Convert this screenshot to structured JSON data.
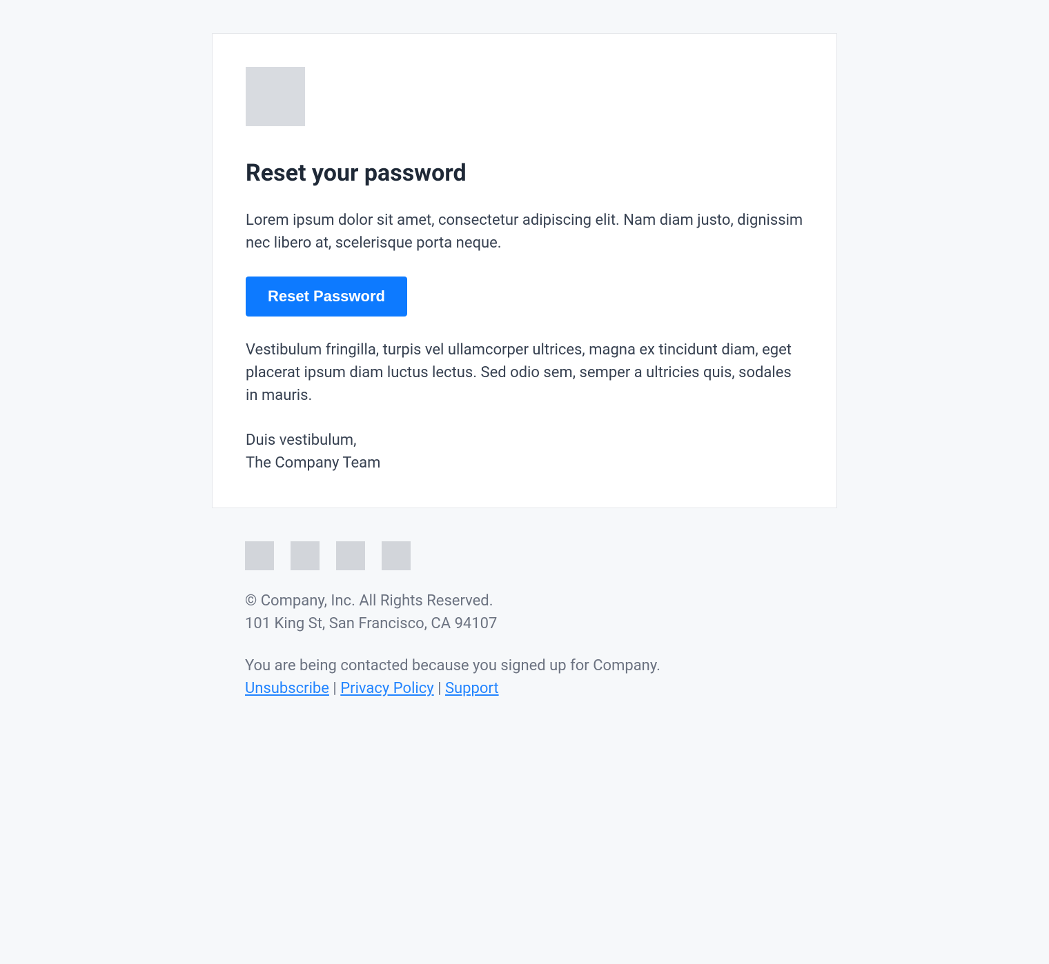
{
  "card": {
    "heading": "Reset your password",
    "intro": "Lorem ipsum dolor sit amet, consectetur adipiscing elit. Nam diam justo, dignissim nec libero at, scelerisque porta neque.",
    "button_label": "Reset Password",
    "followup": "Vestibulum fringilla, turpis vel ullamcorper ultrices, magna ex tincidunt diam, eget placerat ipsum diam luctus lectus. Sed odio sem, semper a ultricies quis, sodales in mauris.",
    "closing_line1": "Duis vestibulum,",
    "closing_line2": "The Company Team"
  },
  "footer": {
    "copyright": "© Company, Inc. All Rights Reserved.",
    "address": "101 King St, San Francisco, CA 94107",
    "contact_reason": "You are being contacted because you signed up for Company.",
    "links": {
      "unsubscribe": "Unsubscribe",
      "privacy": "Privacy Policy",
      "support": "Support"
    },
    "separator": " | "
  }
}
